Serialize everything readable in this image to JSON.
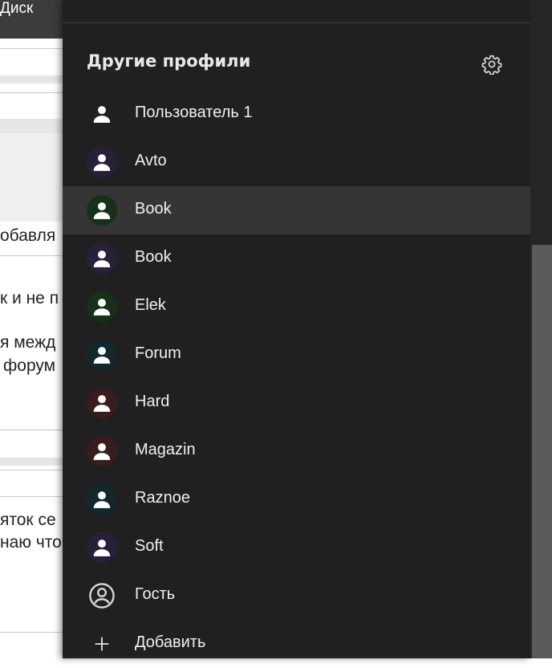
{
  "background_page": {
    "top_tab_text": "Диск",
    "snippets": [
      "обавля",
      "к и не п",
      "я межд",
      "форум",
      "яток се",
      "наю что"
    ]
  },
  "panel": {
    "title": "Другие профили",
    "settings_icon": "gear-icon",
    "profiles": [
      {
        "label": "Пользователь 1",
        "avatar_color": "#202020",
        "icon": "person-icon"
      },
      {
        "label": "Avto",
        "avatar_color": "#2a1f3b",
        "icon": "person-icon"
      },
      {
        "label": "Book",
        "avatar_color": "#173018",
        "icon": "person-icon",
        "active": true
      },
      {
        "label": "Book",
        "avatar_color": "#2a1f3b",
        "icon": "person-icon"
      },
      {
        "label": "Elek",
        "avatar_color": "#173018",
        "icon": "person-icon"
      },
      {
        "label": "Forum",
        "avatar_color": "#13282c",
        "icon": "person-icon"
      },
      {
        "label": "Hard",
        "avatar_color": "#3a1c1c",
        "icon": "person-icon"
      },
      {
        "label": "Magazin",
        "avatar_color": "#3a1c1c",
        "icon": "person-icon"
      },
      {
        "label": "Raznoe",
        "avatar_color": "#13282c",
        "icon": "person-icon"
      },
      {
        "label": "Soft",
        "avatar_color": "#2a1f3b",
        "icon": "person-icon"
      }
    ],
    "guest": {
      "label": "Гость",
      "icon": "guest-circle-icon"
    },
    "add": {
      "label": "Добавить",
      "icon": "plus-icon"
    }
  },
  "colors": {
    "panel_bg": "#202020",
    "active_row_bg": "#353535",
    "text": "#f0f0f0"
  }
}
